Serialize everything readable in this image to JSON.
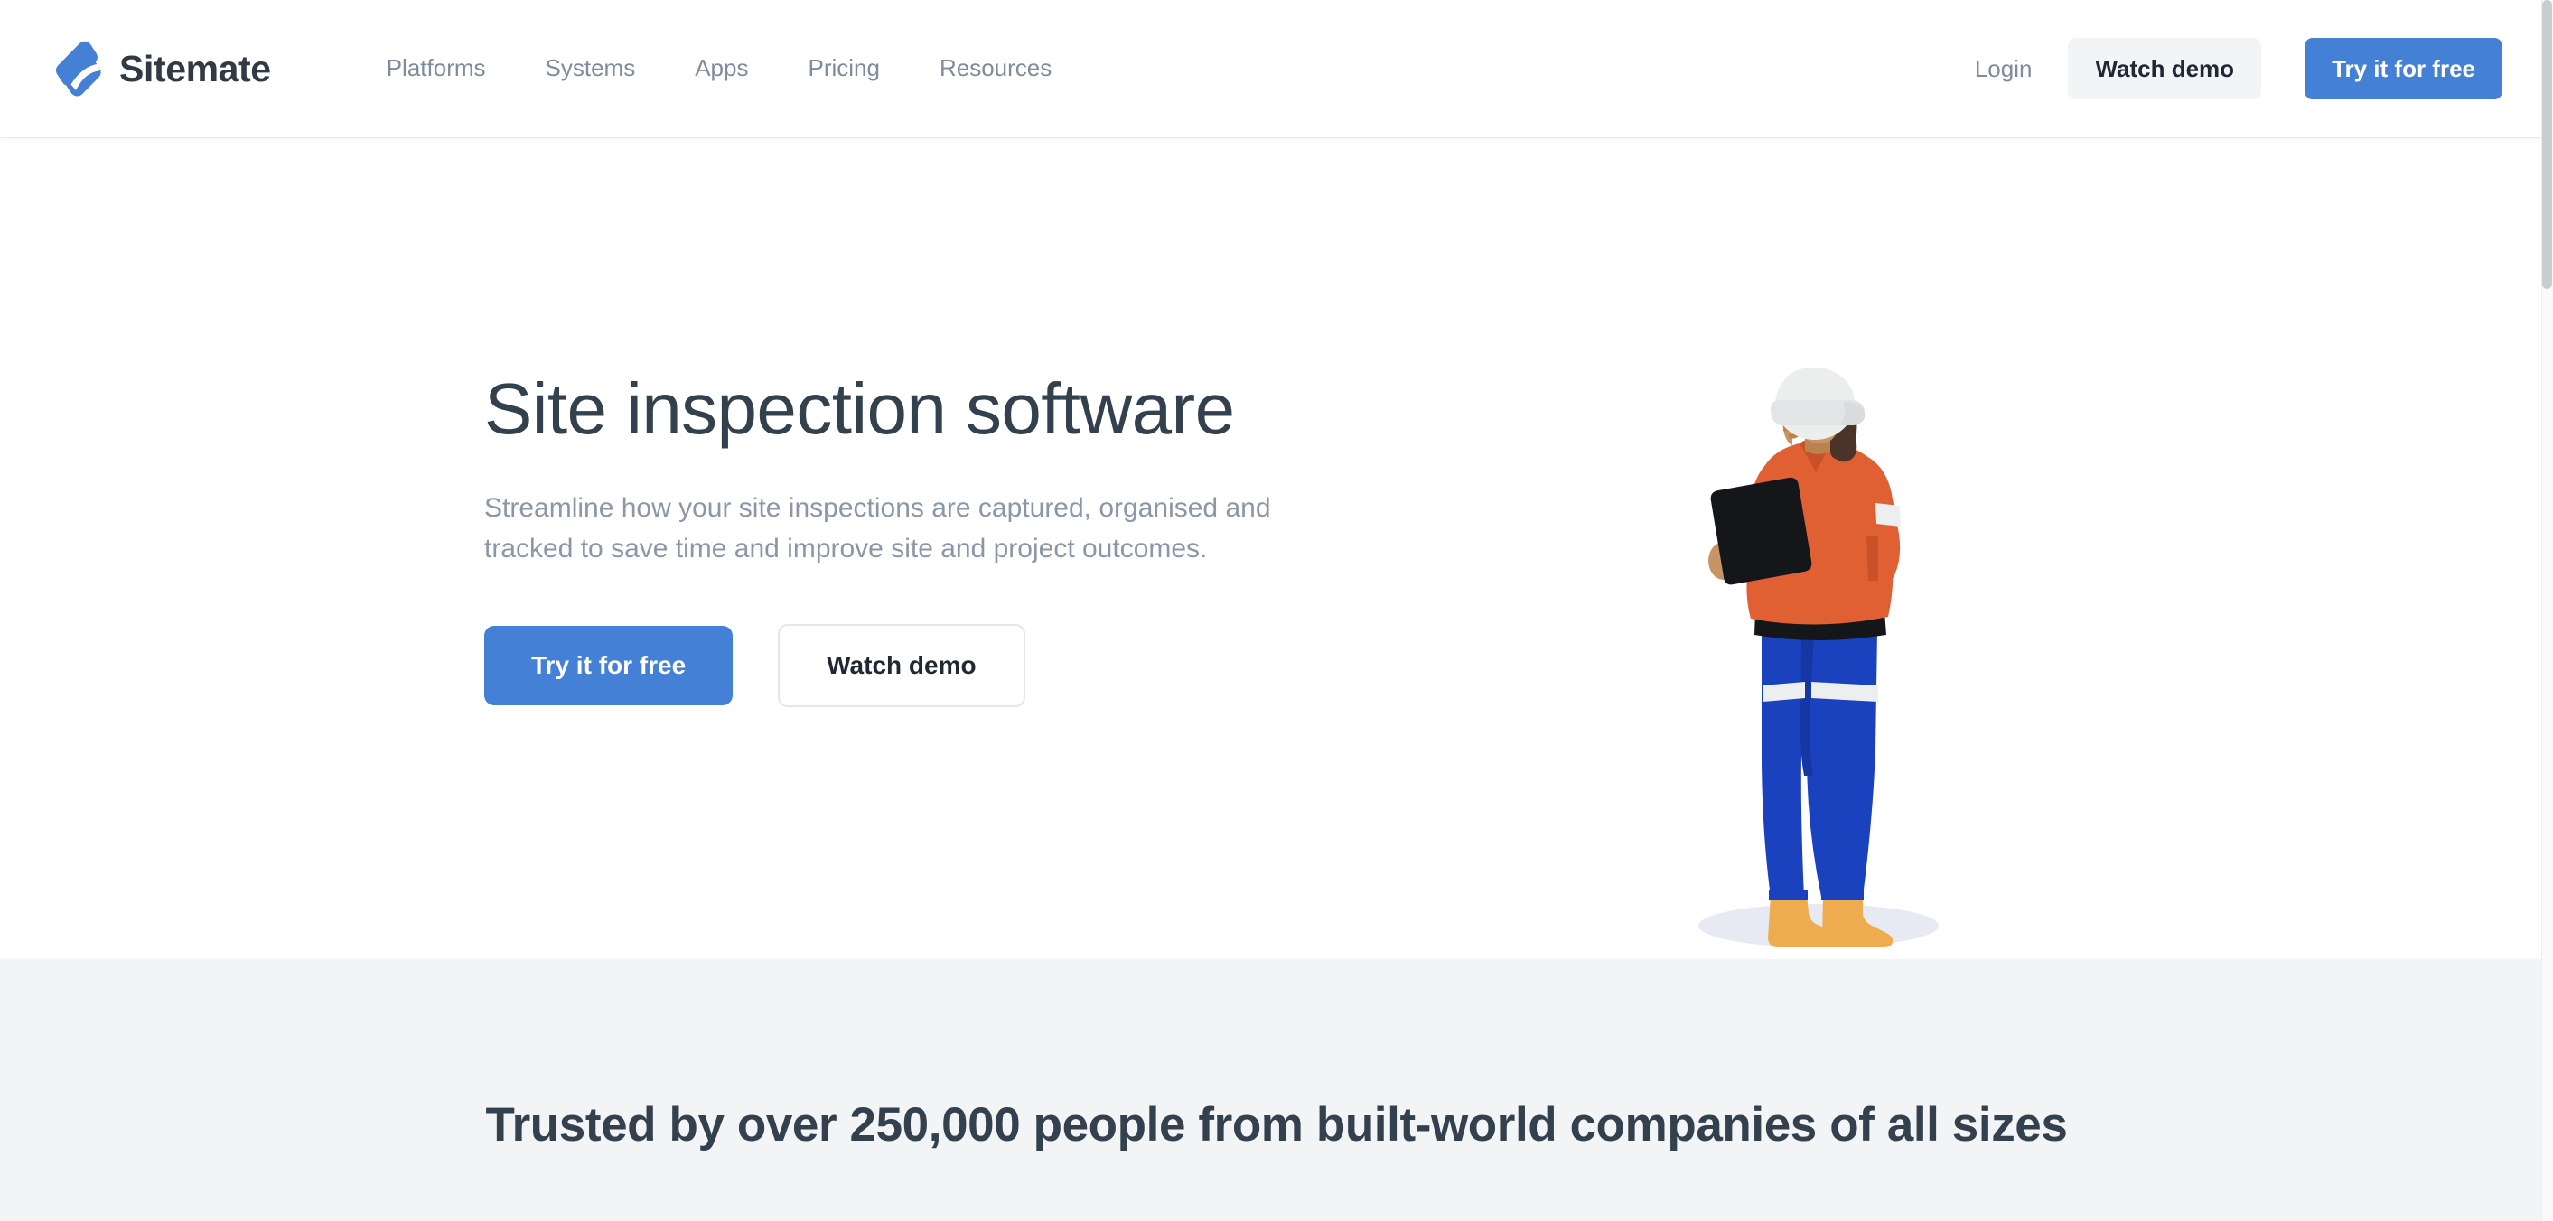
{
  "header": {
    "brand": {
      "name": "Sitemate",
      "logo_icon": "sitemate-s-logo-icon",
      "logo_color": "#4480d6",
      "text_color": "#2f3a45"
    },
    "nav": [
      {
        "label": "Platforms"
      },
      {
        "label": "Systems"
      },
      {
        "label": "Apps"
      },
      {
        "label": "Pricing"
      },
      {
        "label": "Resources"
      }
    ],
    "login_label": "Login",
    "watch_demo_label": "Watch demo",
    "try_free_label": "Try it for free"
  },
  "hero": {
    "title": "Site inspection software",
    "subtitle": "Streamline how your site inspections are captured, organised and tracked to save time and improve site and project outcomes.",
    "primary_cta": "Try it for free",
    "secondary_cta": "Watch demo",
    "illustration": {
      "name": "site-inspector-worker-illustration",
      "description": "Worker with white hard hat holding a black tablet, wearing orange hi-vis shirt and blue trousers",
      "colors": {
        "helmet": "#eceded",
        "helmet_shadow": "#d9dcdd",
        "skin": "#c99465",
        "skin_shadow": "#b9824f",
        "hair": "#4a342a",
        "shirt": "#e05f33",
        "shirt_shadow": "#c9512a",
        "belt": "#15161a",
        "tablet": "#15161a",
        "pants": "#1a42bf",
        "pants_shadow": "#1536a3",
        "reflective_band": "#eceef0",
        "boots": "#eeab50",
        "ground_shadow": "#e8eaf3"
      }
    }
  },
  "trusted": {
    "heading": "Trusted by over 250,000 people from built-world companies of all sizes",
    "background": "#f3f4f6"
  },
  "theme": {
    "accent_blue": "#4480d6",
    "text_dark": "#33404d",
    "text_muted": "#8b97a8",
    "surface_light": "#f3f4f6"
  }
}
